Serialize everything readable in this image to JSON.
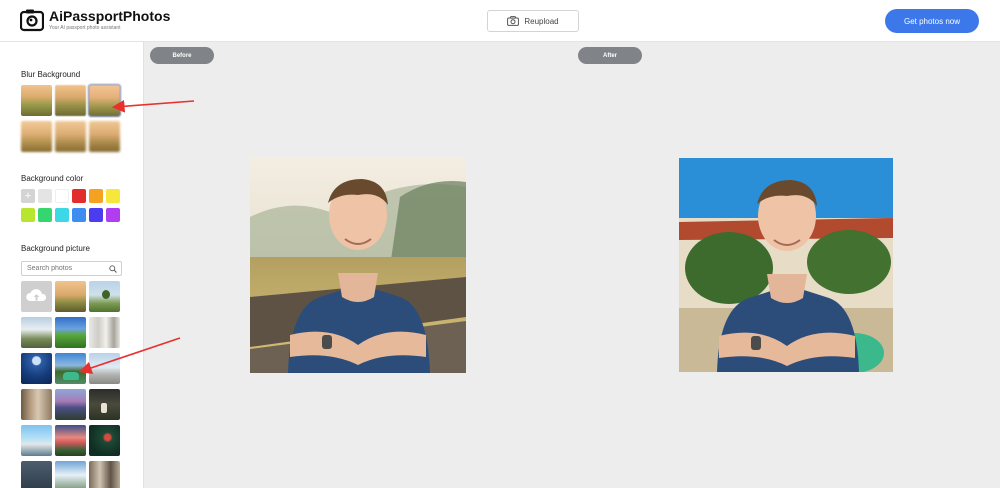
{
  "header": {
    "brand": "AiPassportPhotos",
    "tagline": "Your AI passport photo assistant",
    "reupload_label": "Reupload",
    "get_photos_label": "Get photos now"
  },
  "sidebar": {
    "blur_title": "Blur Background",
    "color_title": "Background color",
    "picture_title": "Background picture",
    "search_placeholder": "Search photos",
    "colors": [
      "#e4e4e4",
      "#ffffff",
      "#e32d2d",
      "#f5a122",
      "#f5e83a",
      "#b8e62e",
      "#35d56f",
      "#3dd8e6",
      "#3d8ef0",
      "#4c3cf0",
      "#b03ef0"
    ]
  },
  "main": {
    "before_label": "Before",
    "after_label": "After"
  }
}
